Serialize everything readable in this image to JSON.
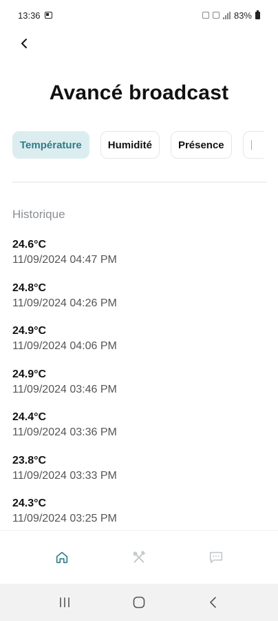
{
  "status_bar": {
    "time": "13:36",
    "battery": "83%"
  },
  "header": {
    "title": "Avancé broadcast"
  },
  "tabs": [
    {
      "label": "Température",
      "active": true
    },
    {
      "label": "Humidité",
      "active": false
    },
    {
      "label": "Présence",
      "active": false
    }
  ],
  "history": {
    "title": "Historique",
    "items": [
      {
        "value": "24.6°C",
        "date": "11/09/2024 04:47 PM"
      },
      {
        "value": "24.8°C",
        "date": "11/09/2024 04:26 PM"
      },
      {
        "value": "24.9°C",
        "date": "11/09/2024 04:06 PM"
      },
      {
        "value": "24.9°C",
        "date": "11/09/2024 03:46 PM"
      },
      {
        "value": "24.4°C",
        "date": "11/09/2024 03:36 PM"
      },
      {
        "value": "23.8°C",
        "date": "11/09/2024 03:33 PM"
      },
      {
        "value": "24.3°C",
        "date": "11/09/2024 03:25 PM"
      }
    ]
  },
  "bottom_nav": {
    "items": [
      {
        "icon": "home-icon",
        "active": true
      },
      {
        "icon": "tools-icon",
        "active": false
      },
      {
        "icon": "chat-icon",
        "active": false
      }
    ]
  },
  "colors": {
    "accent": "#2e7d88",
    "active_tab_bg": "#dcedef",
    "inactive_icon": "#c4c8cc"
  }
}
